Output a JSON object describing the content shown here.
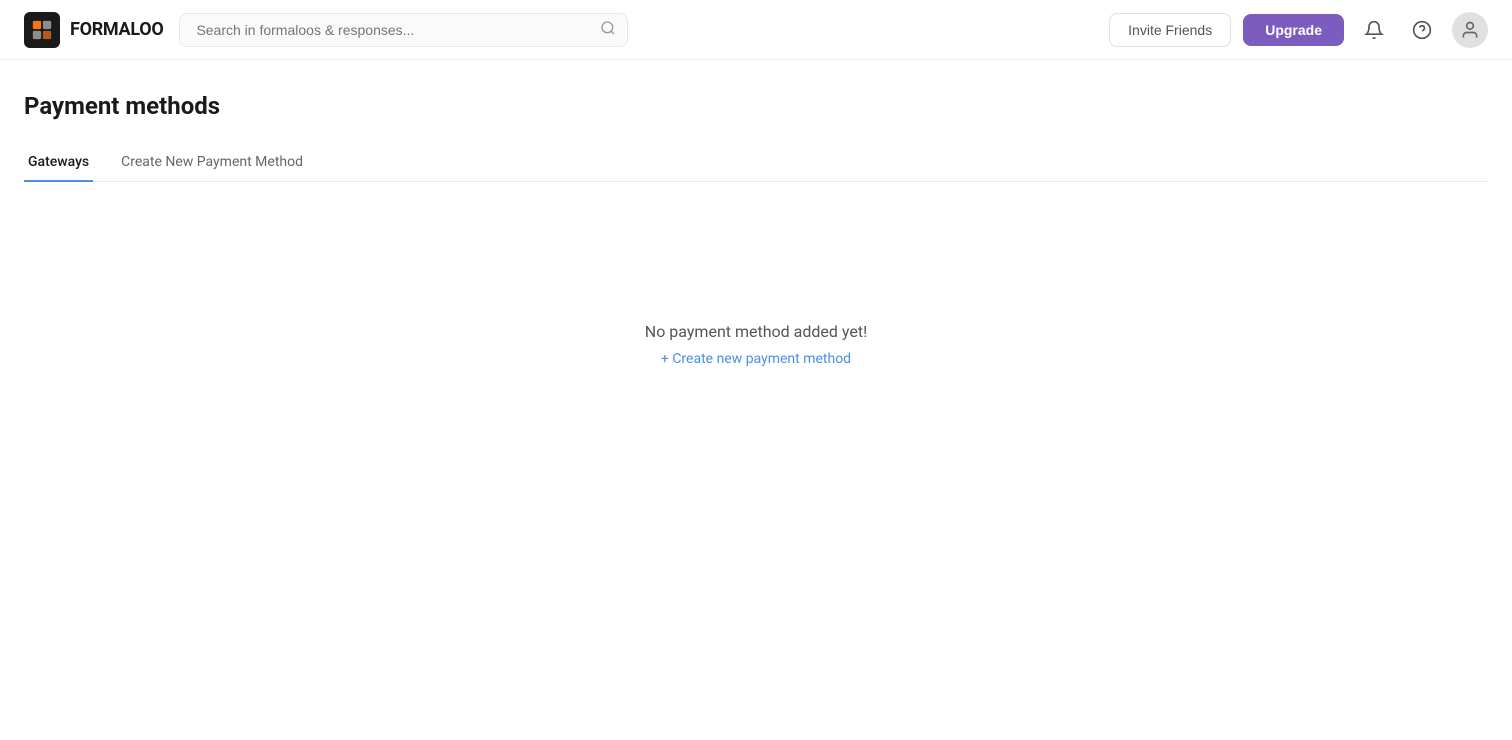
{
  "header": {
    "logo_text": "FORMALOO",
    "search_placeholder": "Search in formaloos & responses...",
    "invite_friends_label": "Invite Friends",
    "upgrade_label": "Upgrade",
    "notification_icon": "🔔",
    "help_icon": "?",
    "avatar_icon": "👤"
  },
  "page": {
    "title": "Payment methods",
    "tabs": [
      {
        "label": "Gateways",
        "active": true
      },
      {
        "label": "Create New Payment Method",
        "active": false
      }
    ],
    "empty_state": {
      "message": "No payment method added yet!",
      "create_link": "+ Create new payment method"
    }
  }
}
